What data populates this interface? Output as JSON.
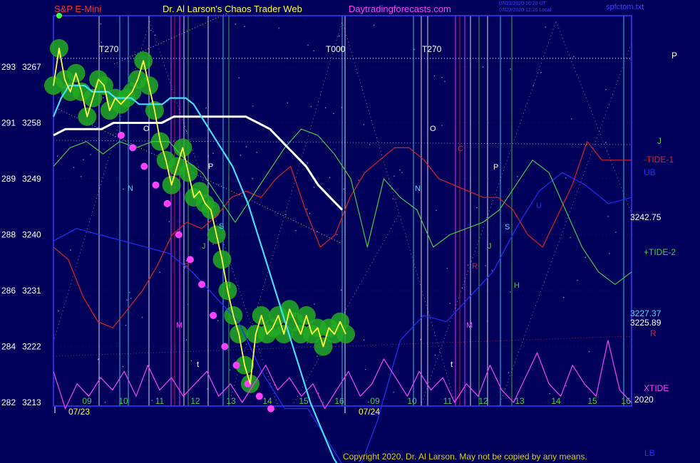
{
  "header": {
    "left": "S&P E-Mini",
    "center": "Dr. Al Larson's Chaos Trader Web",
    "site": "Daytradingforecasts.com",
    "stamp_line1": "07/23/2020 16:20 UT",
    "stamp_line2": "07/23/2020 12:20 Local",
    "file": "spfctom.txt"
  },
  "copyright": "Copyright 2020, Dr. Al Larson. May not be copied by any means.",
  "colors": {
    "background": "#00005a",
    "frame": "#3a3aff",
    "price": "#ffff40",
    "glow": "#22aa22",
    "magenta": "#ff40ff",
    "cyan": "#40e0ff",
    "white": "#ffffff",
    "green": "#44cc44",
    "red": "#e02020",
    "blue": "#2030ff"
  },
  "chart_data": {
    "type": "line",
    "y_axis_left_labels": [
      "293",
      "291",
      "289",
      "288",
      "286",
      "284",
      "282"
    ],
    "y_axis_prices": [
      3267,
      3258,
      3249,
      3240,
      3231,
      3222,
      3213
    ],
    "ylim": [
      3213,
      3267
    ],
    "x_hour_labels": [
      "09",
      "10",
      "11",
      "12",
      "13",
      "14",
      "15",
      "16",
      "09",
      "10",
      "11",
      "12",
      "13",
      "14",
      "15",
      "16"
    ],
    "date_labels": [
      "07/23",
      "07/24"
    ],
    "cycle_labels": [
      "T270",
      "T000",
      "T270"
    ],
    "flux_letters": [
      {
        "t": "O",
        "color": "#ffffff"
      },
      {
        "t": "N",
        "color": "#40e0ff"
      },
      {
        "t": "P",
        "color": "#ffffff"
      },
      {
        "t": "S",
        "color": "#40e0ff"
      },
      {
        "t": "J",
        "color": "#44cc44"
      },
      {
        "t": "H",
        "color": "#44cc44"
      },
      {
        "t": "R",
        "color": "#e02020"
      },
      {
        "t": "M",
        "color": "#ff40ff"
      },
      {
        "t": "t",
        "color": "#ffffff"
      },
      {
        "t": "O",
        "color": "#ffffff"
      },
      {
        "t": "N",
        "color": "#40e0ff"
      },
      {
        "t": "C",
        "color": "#e02020"
      },
      {
        "t": "P",
        "color": "#ffffff"
      },
      {
        "t": "S",
        "color": "#40e0ff"
      },
      {
        "t": "J",
        "color": "#44cc44"
      },
      {
        "t": "H",
        "color": "#44cc44"
      },
      {
        "t": "R",
        "color": "#e02020"
      },
      {
        "t": "M",
        "color": "#ff40ff"
      },
      {
        "t": "t",
        "color": "#ffffff"
      },
      {
        "t": "U",
        "color": "#2030ff"
      }
    ],
    "right_labels": [
      {
        "t": "P",
        "color": "#ffffff"
      },
      {
        "t": "J",
        "color": "#44cc44"
      },
      {
        "t": "-TIDE-1",
        "color": "#e02020"
      },
      {
        "t": "UB",
        "color": "#2030ff"
      },
      {
        "t": "3242.75",
        "color": "#ffffff"
      },
      {
        "t": "+TIDE-2",
        "color": "#44cc44"
      },
      {
        "t": "3227.37",
        "color": "#40e0ff"
      },
      {
        "t": "3225.89",
        "color": "#ffffff"
      },
      {
        "t": "R",
        "color": "#e02020"
      },
      {
        "t": "XTIDE",
        "color": "#ff40ff"
      },
      {
        "t": "2020",
        "color": "#ffffff"
      },
      {
        "t": "LB",
        "color": "#2030ff"
      }
    ],
    "series": [
      {
        "role": "price",
        "color": "#ffff40",
        "values": [
          3264,
          3270,
          3265,
          3263,
          3266,
          3263,
          3259,
          3262,
          3265,
          3264,
          3260,
          3262,
          3261,
          3262,
          3263,
          3265,
          3268,
          3264,
          3260,
          3255,
          3252,
          3248,
          3251,
          3254,
          3250,
          3246,
          3247,
          3245,
          3244,
          3240,
          3236,
          3231,
          3227,
          3224,
          3219,
          3216,
          3224,
          3227,
          3224,
          3225,
          3227,
          3224,
          3228,
          3226,
          3224,
          3227,
          3224,
          3225,
          3222,
          3225,
          3224,
          3226,
          3224
        ]
      },
      {
        "role": "ma-cyan",
        "color": "#40e0ff",
        "values": [
          3259,
          3262,
          3264,
          3264,
          3264,
          3263,
          3263,
          3263,
          3262,
          3262,
          3262,
          3261,
          3261,
          3261,
          3261,
          3262,
          3262,
          3262,
          3261,
          3259,
          3257,
          3255,
          3253,
          3251,
          3248,
          3245,
          3241,
          3237,
          3233,
          3229,
          3225,
          3221,
          3217,
          3213,
          3210,
          3207,
          3204,
          3202,
          3201
        ]
      },
      {
        "role": "ma-white",
        "color": "#ffffff",
        "values": [
          3256,
          3257,
          3257,
          3257,
          3257,
          3258,
          3258,
          3258,
          3258,
          3258,
          3259,
          3259,
          3259,
          3259,
          3259,
          3259,
          3259,
          3258,
          3257,
          3255,
          3253,
          3251,
          3248,
          3246,
          3244
        ]
      },
      {
        "role": "tide-green",
        "color": "#44cc44",
        "values": [
          3251,
          3254,
          3255,
          3253,
          3255,
          3254,
          3255,
          3255,
          3252,
          3250,
          3246,
          3242,
          3246,
          3250,
          3254,
          3257,
          3256,
          3253,
          3249,
          3238,
          3249,
          3246,
          3244,
          3238,
          3240,
          3241,
          3242,
          3244,
          3248,
          3252,
          3250,
          3244,
          3238,
          3234,
          3232,
          3234
        ]
      },
      {
        "role": "tide-red",
        "color": "#e02020",
        "values": [
          3238,
          3236,
          3230,
          3226,
          3225,
          3228,
          3231,
          3235,
          3240,
          3242,
          3241,
          3243,
          3246,
          3247,
          3246,
          3249,
          3251,
          3244,
          3238,
          3240,
          3246,
          3250,
          3252,
          3254,
          3254,
          3252,
          3249,
          3248,
          3247,
          3246,
          3246,
          3244,
          3240,
          3238,
          3243,
          3248,
          3255,
          3252,
          3252,
          3252
        ]
      },
      {
        "role": "band-blue",
        "color": "#2030ff",
        "values": [
          3239,
          3241,
          3240,
          3239,
          3238,
          3237,
          3234,
          3230,
          3226,
          3218,
          3212,
          3212,
          3206,
          3200,
          3210,
          3223,
          3227,
          3226,
          3230,
          3234,
          3241,
          3247,
          3250,
          3248,
          3245,
          3246
        ]
      },
      {
        "role": "xtide",
        "color": "#ff40ff",
        "values": [
          3218,
          3212,
          3216,
          3214,
          3217,
          3215,
          3218,
          3214,
          3219,
          3215,
          3217,
          3214,
          3216,
          3218,
          3214,
          3216,
          3213,
          3216,
          3219,
          3215,
          3217,
          3214,
          3216,
          3212,
          3215,
          3218,
          3214,
          3216,
          3220,
          3217,
          3214,
          3218,
          3215,
          3217,
          3213,
          3216,
          3214,
          3219,
          3215,
          3213,
          3217,
          3221,
          3216,
          3214,
          3219,
          3216,
          3214,
          3223,
          3215,
          3213
        ]
      },
      {
        "role": "forecast-dots",
        "color": "#ff40ff",
        "values": [
          3256,
          3254,
          3251,
          3248,
          3245,
          3240,
          3236,
          3232,
          3227,
          3222,
          3219,
          3216,
          3214,
          3212
        ]
      }
    ]
  }
}
